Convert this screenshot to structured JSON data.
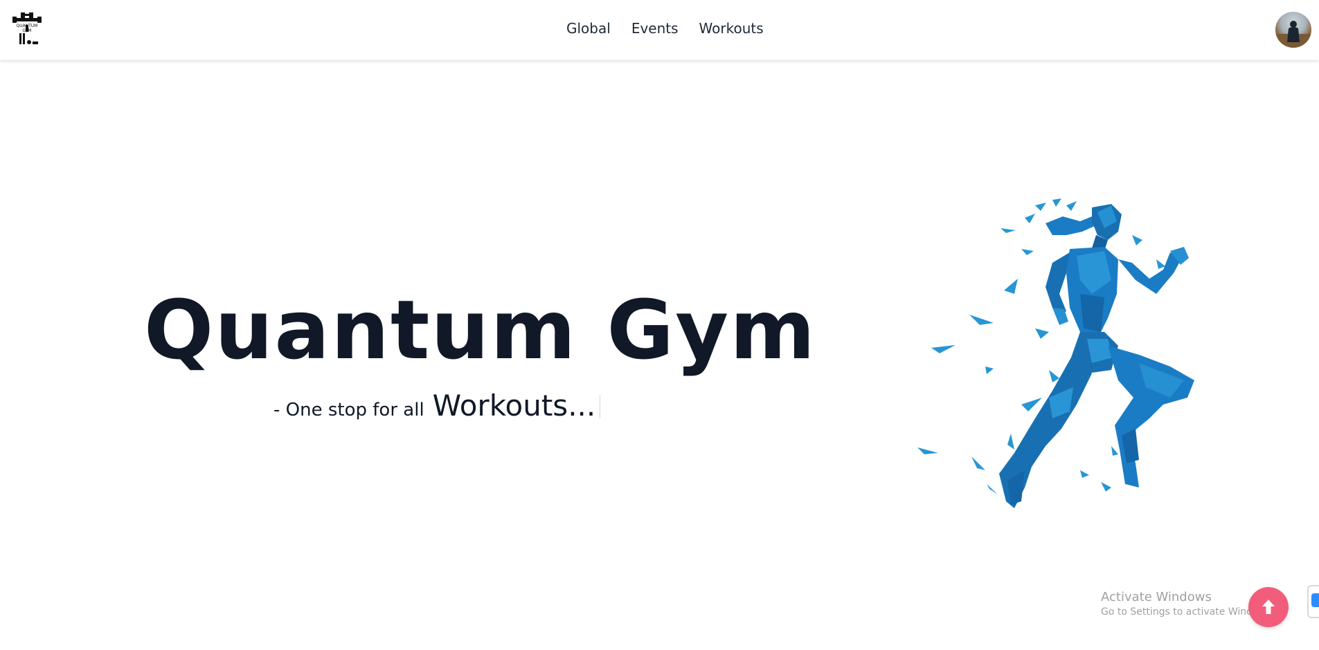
{
  "header": {
    "logo_label": "QUANTUM GYM",
    "nav": [
      {
        "label": "Global"
      },
      {
        "label": "Events"
      },
      {
        "label": "Workouts"
      }
    ]
  },
  "hero": {
    "title": "Quantum Gym",
    "subtitle_prefix": "- One stop for all",
    "subtitle_highlight": "Workouts..."
  },
  "watermark": {
    "title": "Activate Windows",
    "subtitle": "Go to Settings to activate Windows."
  },
  "colors": {
    "accent": "#f25d7c",
    "runner_blue": "#1a7cc4",
    "text": "#111827"
  },
  "icons": {
    "scroll_top": "arrow-up-icon",
    "avatar": "user-avatar"
  }
}
